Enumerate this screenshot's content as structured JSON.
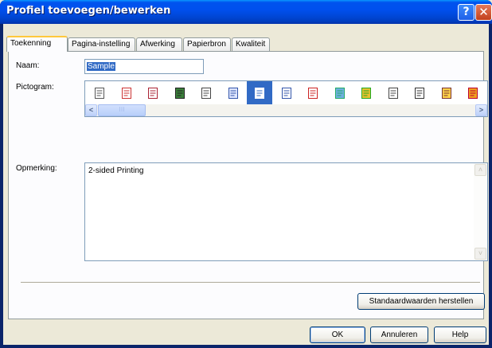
{
  "window": {
    "title": "Profiel toevoegen/bewerken",
    "help_glyph": "?",
    "close_glyph": "✕"
  },
  "tabs": [
    {
      "label": "Toekenning",
      "active": true
    },
    {
      "label": "Pagina-instelling",
      "active": false
    },
    {
      "label": "Afwerking",
      "active": false
    },
    {
      "label": "Papierbron",
      "active": false
    },
    {
      "label": "Kwaliteit",
      "active": false
    }
  ],
  "form": {
    "name_label": "Naam:",
    "name_value": "Sample",
    "icon_label": "Pictogram:",
    "remark_label": "Opmerking:",
    "remark_value": "2-sided Printing"
  },
  "icons": [
    "document-lines-icon",
    "document-lines-red-icon",
    "document-photo-icon",
    "photo-frame-icon",
    "document-duplex-icon",
    "multi-page-icon",
    "booklet-icon",
    "a4-size-icon",
    "calendar-icon",
    "photo-color-icon",
    "color-document-icon",
    "document-gray-icon",
    "document-stack-icon",
    "color-print-icon",
    "stamp-icon"
  ],
  "icon_selected_index": 6,
  "scroll": {
    "left_glyph": "<",
    "right_glyph": ">",
    "up_glyph": "˄",
    "down_glyph": "˅"
  },
  "buttons": {
    "restore_defaults": "Standaardwaarden herstellen",
    "ok": "OK",
    "cancel": "Annuleren",
    "help": "Help"
  },
  "colors": {
    "titlebar": "#0053ee",
    "selection": "#316ac5",
    "tab_highlight": "#ffc83c"
  }
}
